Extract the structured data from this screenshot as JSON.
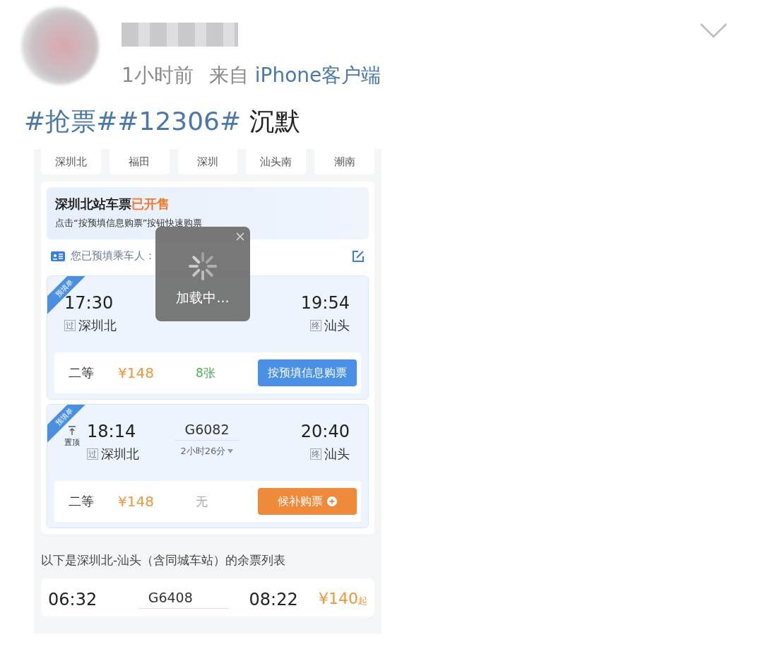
{
  "post": {
    "time": "1小时前",
    "source_prefix": "来自",
    "source": "iPhone客户端",
    "text": [
      {
        "kind": "tag",
        "text": "#抢票#"
      },
      {
        "kind": "tag",
        "text": "#12306#"
      },
      {
        "kind": "plain",
        "text": " 沉默"
      }
    ]
  },
  "app": {
    "stations": [
      "深圳北",
      "福田",
      "深圳",
      "汕头南",
      "潮南"
    ],
    "notice": {
      "title": "深圳北站车票",
      "status": "已开售",
      "hint": "点击“按预填信息购票”按钮快速购票"
    },
    "passenger_label": "您已预填乘车人：",
    "trains": [
      {
        "ribbon": "预填单",
        "depart": "17:30",
        "depart_tag": "过",
        "depart_station": "深圳北",
        "arrive": "19:54",
        "arrive_tag": "终",
        "arrive_station": "汕头",
        "seat": "二等",
        "price": "¥148",
        "seats_left": "8张",
        "available": true,
        "button": {
          "kind": "prefill",
          "label": "按预填信息购票"
        }
      },
      {
        "ribbon": "预填单",
        "pin": "置顶",
        "depart": "18:14",
        "depart_tag": "过",
        "depart_station": "深圳北",
        "train_no": "G6082",
        "duration": "2小时26分",
        "arrive": "20:40",
        "arrive_tag": "终",
        "arrive_station": "汕头",
        "seat": "二等",
        "price": "¥148",
        "seats_left": "无",
        "available": false,
        "button": {
          "kind": "waitlist",
          "label": "候补购票"
        }
      }
    ],
    "list_heading": "以下是深圳北-汕头（含同城车站）的余票列表",
    "list": [
      {
        "depart": "06:32",
        "train_no": "G6408",
        "arrive": "08:22",
        "price": "¥140",
        "price_suffix": "起"
      }
    ],
    "loading": {
      "text": "加载中..."
    }
  }
}
